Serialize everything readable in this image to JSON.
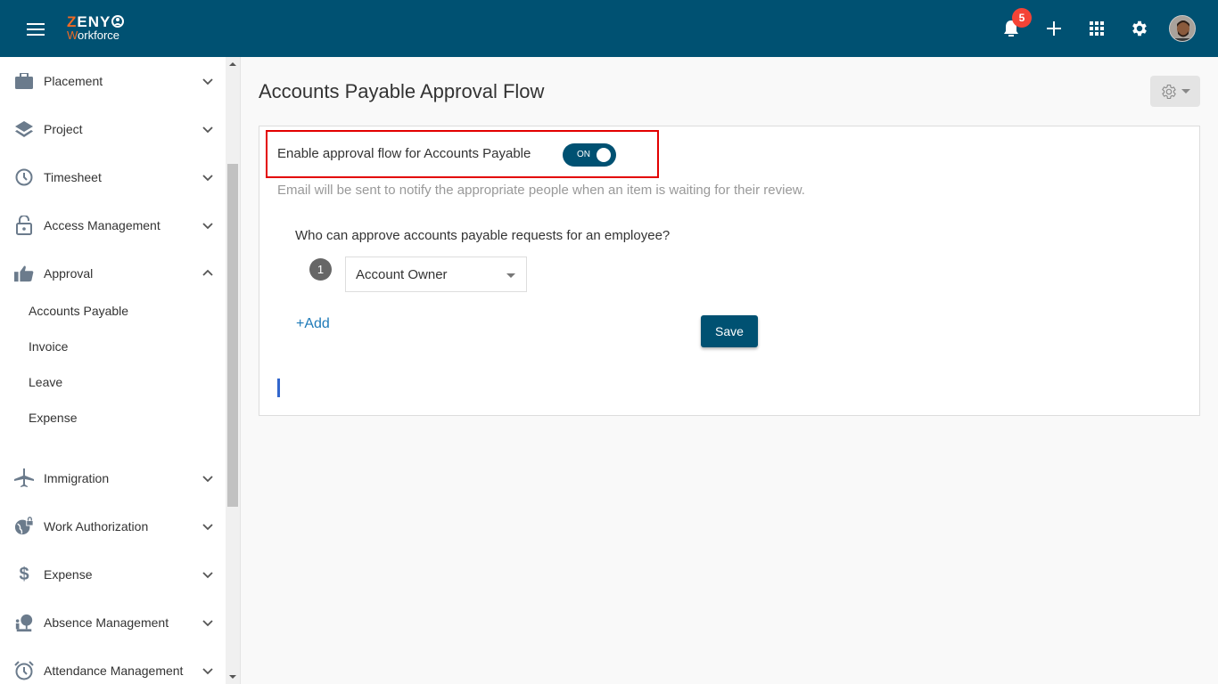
{
  "header": {
    "logo_line1_first": "Z",
    "logo_line1_rest": "ENY",
    "logo_line2_first": "W",
    "logo_line2_rest": "orkforce",
    "notification_count": "5",
    "icons": [
      "menu-icon",
      "bell-icon",
      "plus-icon",
      "apps-grid-icon",
      "gear-icon",
      "avatar"
    ]
  },
  "sidebar": {
    "items": [
      {
        "label": "Placement",
        "icon": "briefcase-icon",
        "expanded": false
      },
      {
        "label": "Project",
        "icon": "layers-icon",
        "expanded": false
      },
      {
        "label": "Timesheet",
        "icon": "clock-icon",
        "expanded": false
      },
      {
        "label": "Access Management",
        "icon": "lock-icon",
        "expanded": false
      },
      {
        "label": "Approval",
        "icon": "thumbs-up-icon",
        "expanded": true
      },
      {
        "label": "Immigration",
        "icon": "airplane-icon",
        "expanded": false
      },
      {
        "label": "Work Authorization",
        "icon": "globe-lock-icon",
        "expanded": false
      },
      {
        "label": "Expense",
        "icon": "dollar-icon",
        "expanded": false
      },
      {
        "label": "Absence Management",
        "icon": "beach-icon",
        "expanded": false
      },
      {
        "label": "Attendance Management",
        "icon": "alarm-clock-icon",
        "expanded": false
      }
    ],
    "approval_subitems": [
      "Accounts Payable",
      "Invoice",
      "Leave",
      "Expense"
    ]
  },
  "main": {
    "title": "Accounts Payable Approval Flow",
    "enable_label": "Enable approval flow for Accounts Payable",
    "toggle_state": "ON",
    "email_note": "Email will be sent to notify the appropriate people when an item is waiting for their review.",
    "question": "Who can approve accounts payable requests for an employee?",
    "approvers": [
      {
        "step": "1",
        "value": "Account Owner"
      }
    ],
    "add_label": "+Add",
    "save_label": "Save"
  },
  "colors": {
    "brand": "#005172",
    "accent_orange": "#f06a24",
    "badge_red": "#f44336",
    "highlight_red": "#e30000",
    "link_blue": "#1e7ab8"
  }
}
